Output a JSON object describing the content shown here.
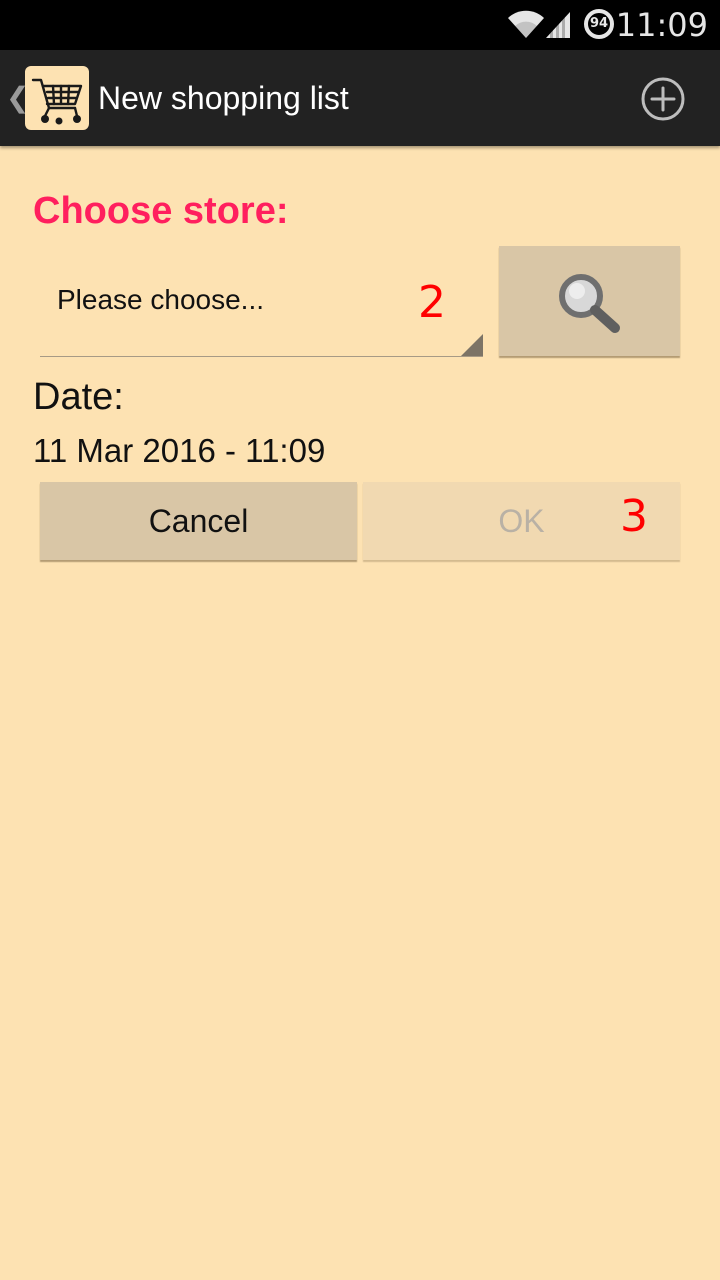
{
  "status_bar": {
    "time": "11:09",
    "battery_level": "94",
    "icons": [
      "wifi-icon",
      "signal-icon",
      "battery-icon"
    ]
  },
  "action_bar": {
    "title": "New shopping list",
    "logo_icon": "shopping-cart-icon",
    "action_icon": "add-circle-icon",
    "background": "#222222"
  },
  "form": {
    "store_label": "Choose store:",
    "store_placeholder": "Please choose...",
    "search_icon": "search-icon",
    "date_label": "Date:",
    "date_value": "11 Mar 2016 - 11:09"
  },
  "buttons": {
    "cancel_label": "Cancel",
    "ok_label": "OK"
  },
  "annotations": {
    "marker_2": "2",
    "marker_3": "3"
  },
  "colors": {
    "background": "#fde2b2",
    "accent": "#ff1f5e",
    "button": "#d9c6a6",
    "button_disabled": "#f1d9b1",
    "annotation": "#ff0000"
  }
}
